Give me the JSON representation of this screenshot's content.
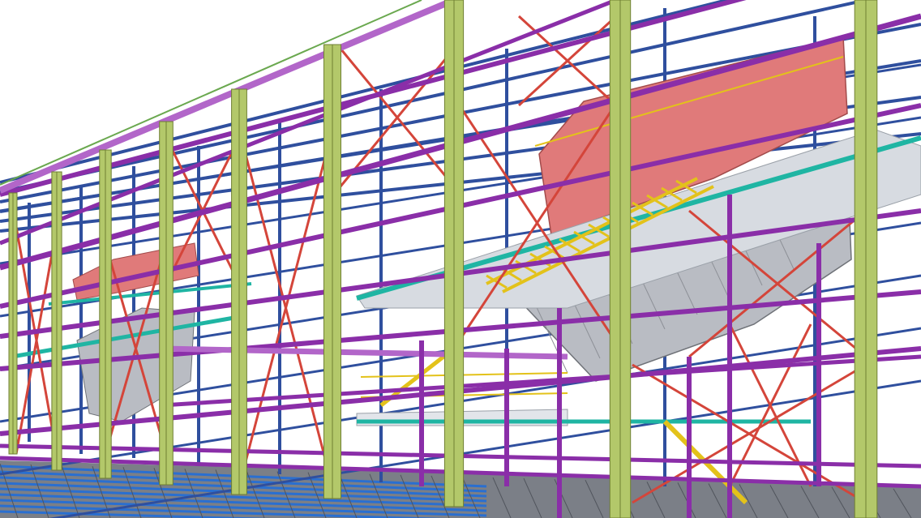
{
  "viewport": {
    "background": "#ffffff"
  },
  "palette": {
    "column": "#b3c86a",
    "column_edge": "#6f7f33",
    "beam_purple": "#8a2ea8",
    "beam_purple_light": "#b266c9",
    "brace_red": "#d4453a",
    "purlin_blue": "#2f4f9e",
    "walkway_teal": "#1fb5a3",
    "stair_yellow": "#e3c21a",
    "equipment_pink": "#e07a7a",
    "chute_grey": "#b9bcc3",
    "floor_blue": "#2a6fd0",
    "floor_grey": "#7b7f87",
    "roof_green": "#6aa84f"
  },
  "model": {
    "type": "3d-steel-structure-view",
    "bays": 6,
    "equipment_units": 2
  }
}
